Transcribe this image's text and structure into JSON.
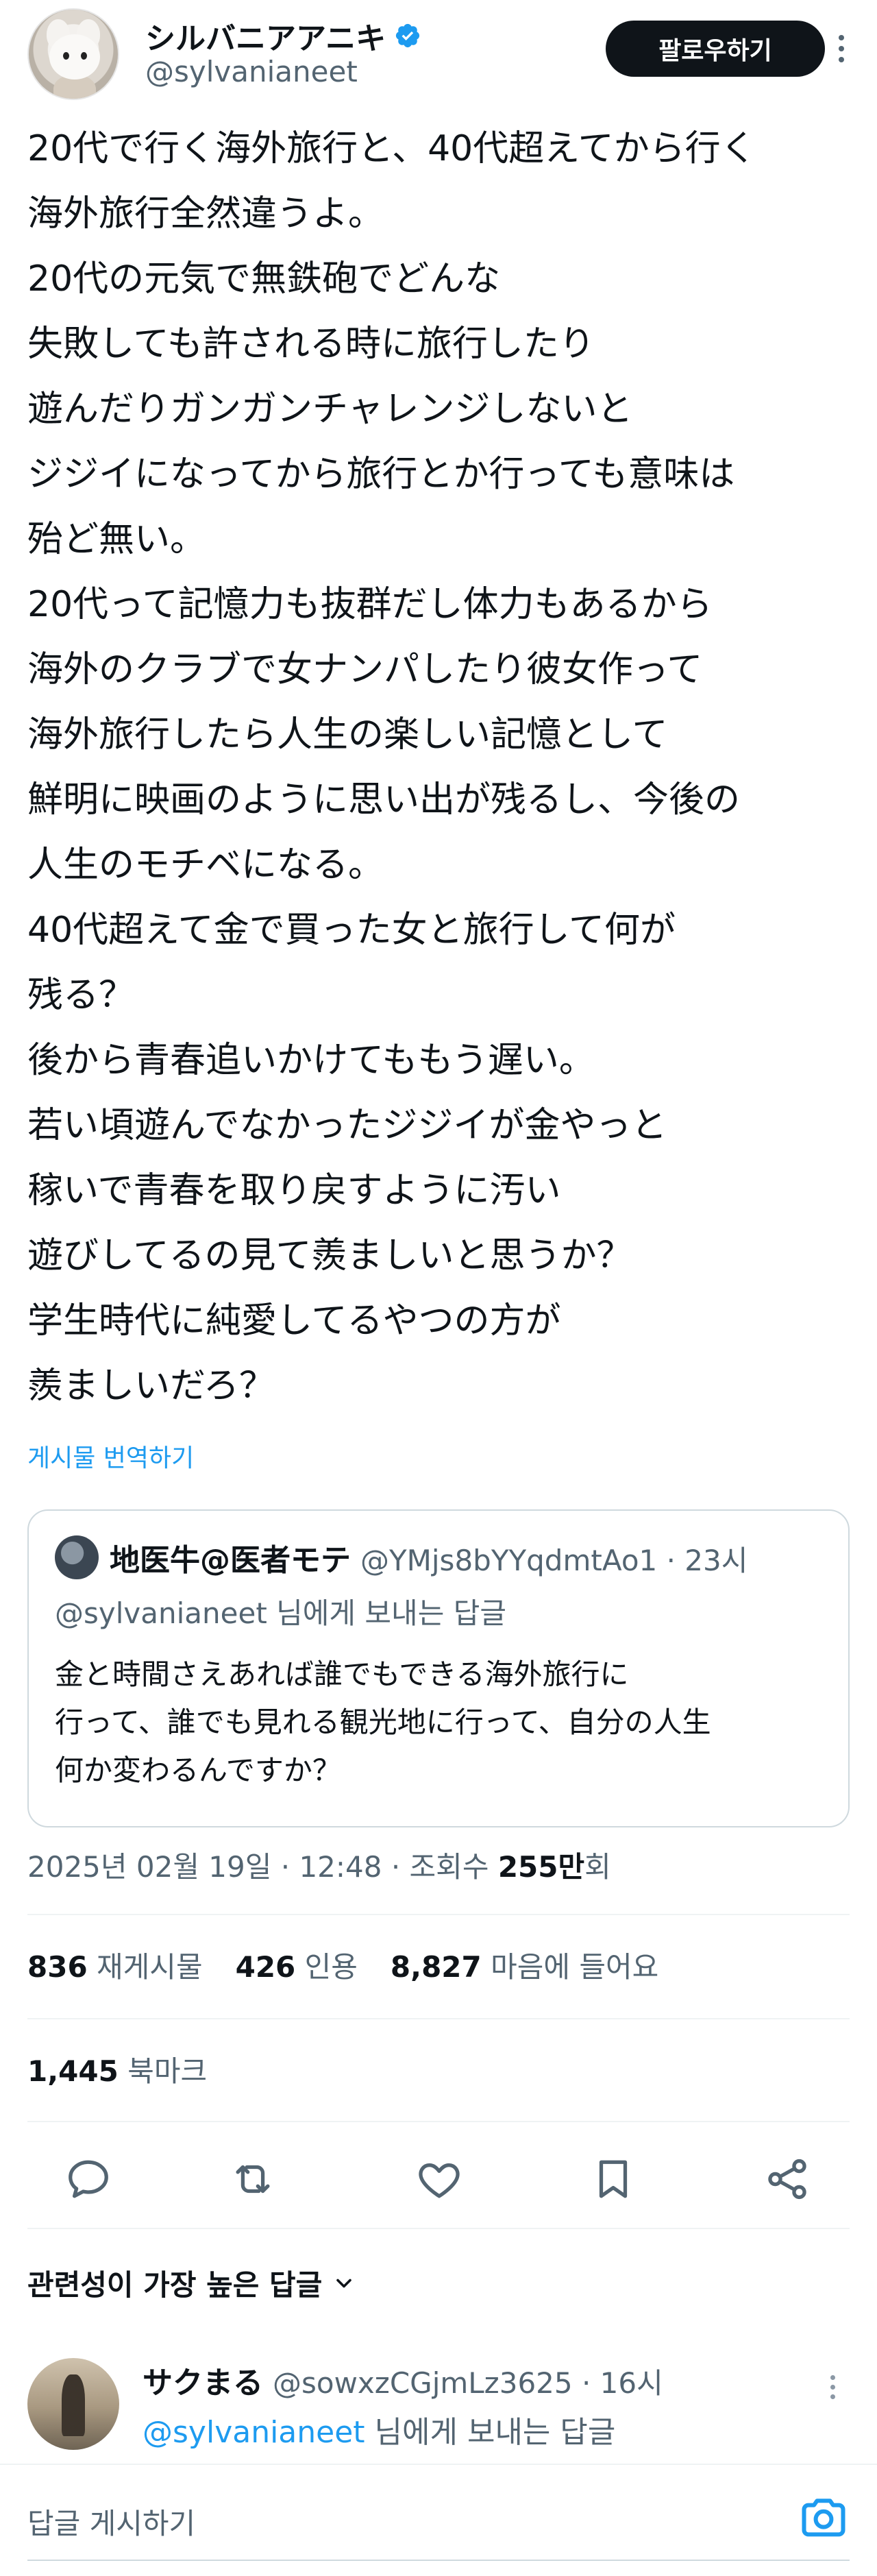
{
  "author": {
    "display_name": "シルバニアアニキ",
    "handle": "@sylvanianeet",
    "follow_label": "팔로우하기"
  },
  "tweet": {
    "lines": [
      "20代で行く海外旅行と、40代超えてから行く",
      "海外旅行全然違うよ。",
      "20代の元気で無鉄砲でどんな",
      "失敗しても許される時に旅行したり",
      "遊んだりガンガンチャレンジしないと",
      "ジジイになってから旅行とか行っても意味は",
      "殆ど無い。",
      "20代って記憶力も抜群だし体力もあるから",
      "海外のクラブで女ナンパしたり彼女作って",
      "海外旅行したら人生の楽しい記憶として",
      "鮮明に映画のように思い出が残るし、今後の",
      "人生のモチベになる。",
      "40代超えて金で買った女と旅行して何が",
      "残る？",
      "後から青春追いかけてももう遅い。",
      "若い頃遊んでなかったジジイが金やっと",
      "稼いで青春を取り戻すように汚い",
      "遊びしてるの見て羨ましいと思うか？",
      "学生時代に純愛してるやつの方が",
      "羨ましいだろ？"
    ],
    "translate_label": "게시물 번역하기"
  },
  "quote": {
    "name": "地医牛@医者モテ",
    "handle_time": "@YMjs8bYYqdmtAo1 · 23시",
    "replying_mention": "@sylvanianeet",
    "replying_suffix": " 님에게 보내는 답글",
    "lines": [
      "金と時間さえあれば誰でもできる海外旅行に",
      "行って、誰でも見れる観光地に行って、自分の人生",
      "何か変わるんですか？"
    ]
  },
  "meta": {
    "datetime": "2025년 02월 19일 · 12:48 · 조회수 ",
    "views_num": "255만",
    "views_suffix": "회"
  },
  "stats": {
    "reposts_num": "836",
    "reposts_label": "재게시물",
    "quotes_num": "426",
    "quotes_label": "인용",
    "likes_num": "8,827",
    "likes_label": "마음에 들어요",
    "bookmarks_num": "1,445",
    "bookmarks_label": "북마크"
  },
  "sort": {
    "label": "관련성이 가장 높은 답글"
  },
  "reply": {
    "name": "サクまる",
    "handle_time": "@sowxzCGjmLz3625 · 16시",
    "replying_mention": "@sylvanianeet",
    "replying_suffix": " 님에게 보내는 답글"
  },
  "composer": {
    "placeholder": "답글 게시하기"
  },
  "icons": {
    "verified": "verified-badge-icon",
    "reply": "reply-icon",
    "repost": "repost-icon",
    "like": "heart-icon",
    "bookmark": "bookmark-icon",
    "share": "share-icon",
    "camera": "camera-icon",
    "chevron": "chevron-down-icon"
  },
  "colors": {
    "accent": "#1d9bf0",
    "text": "#0f1419",
    "secondary": "#536471",
    "button": "#0f1419"
  }
}
